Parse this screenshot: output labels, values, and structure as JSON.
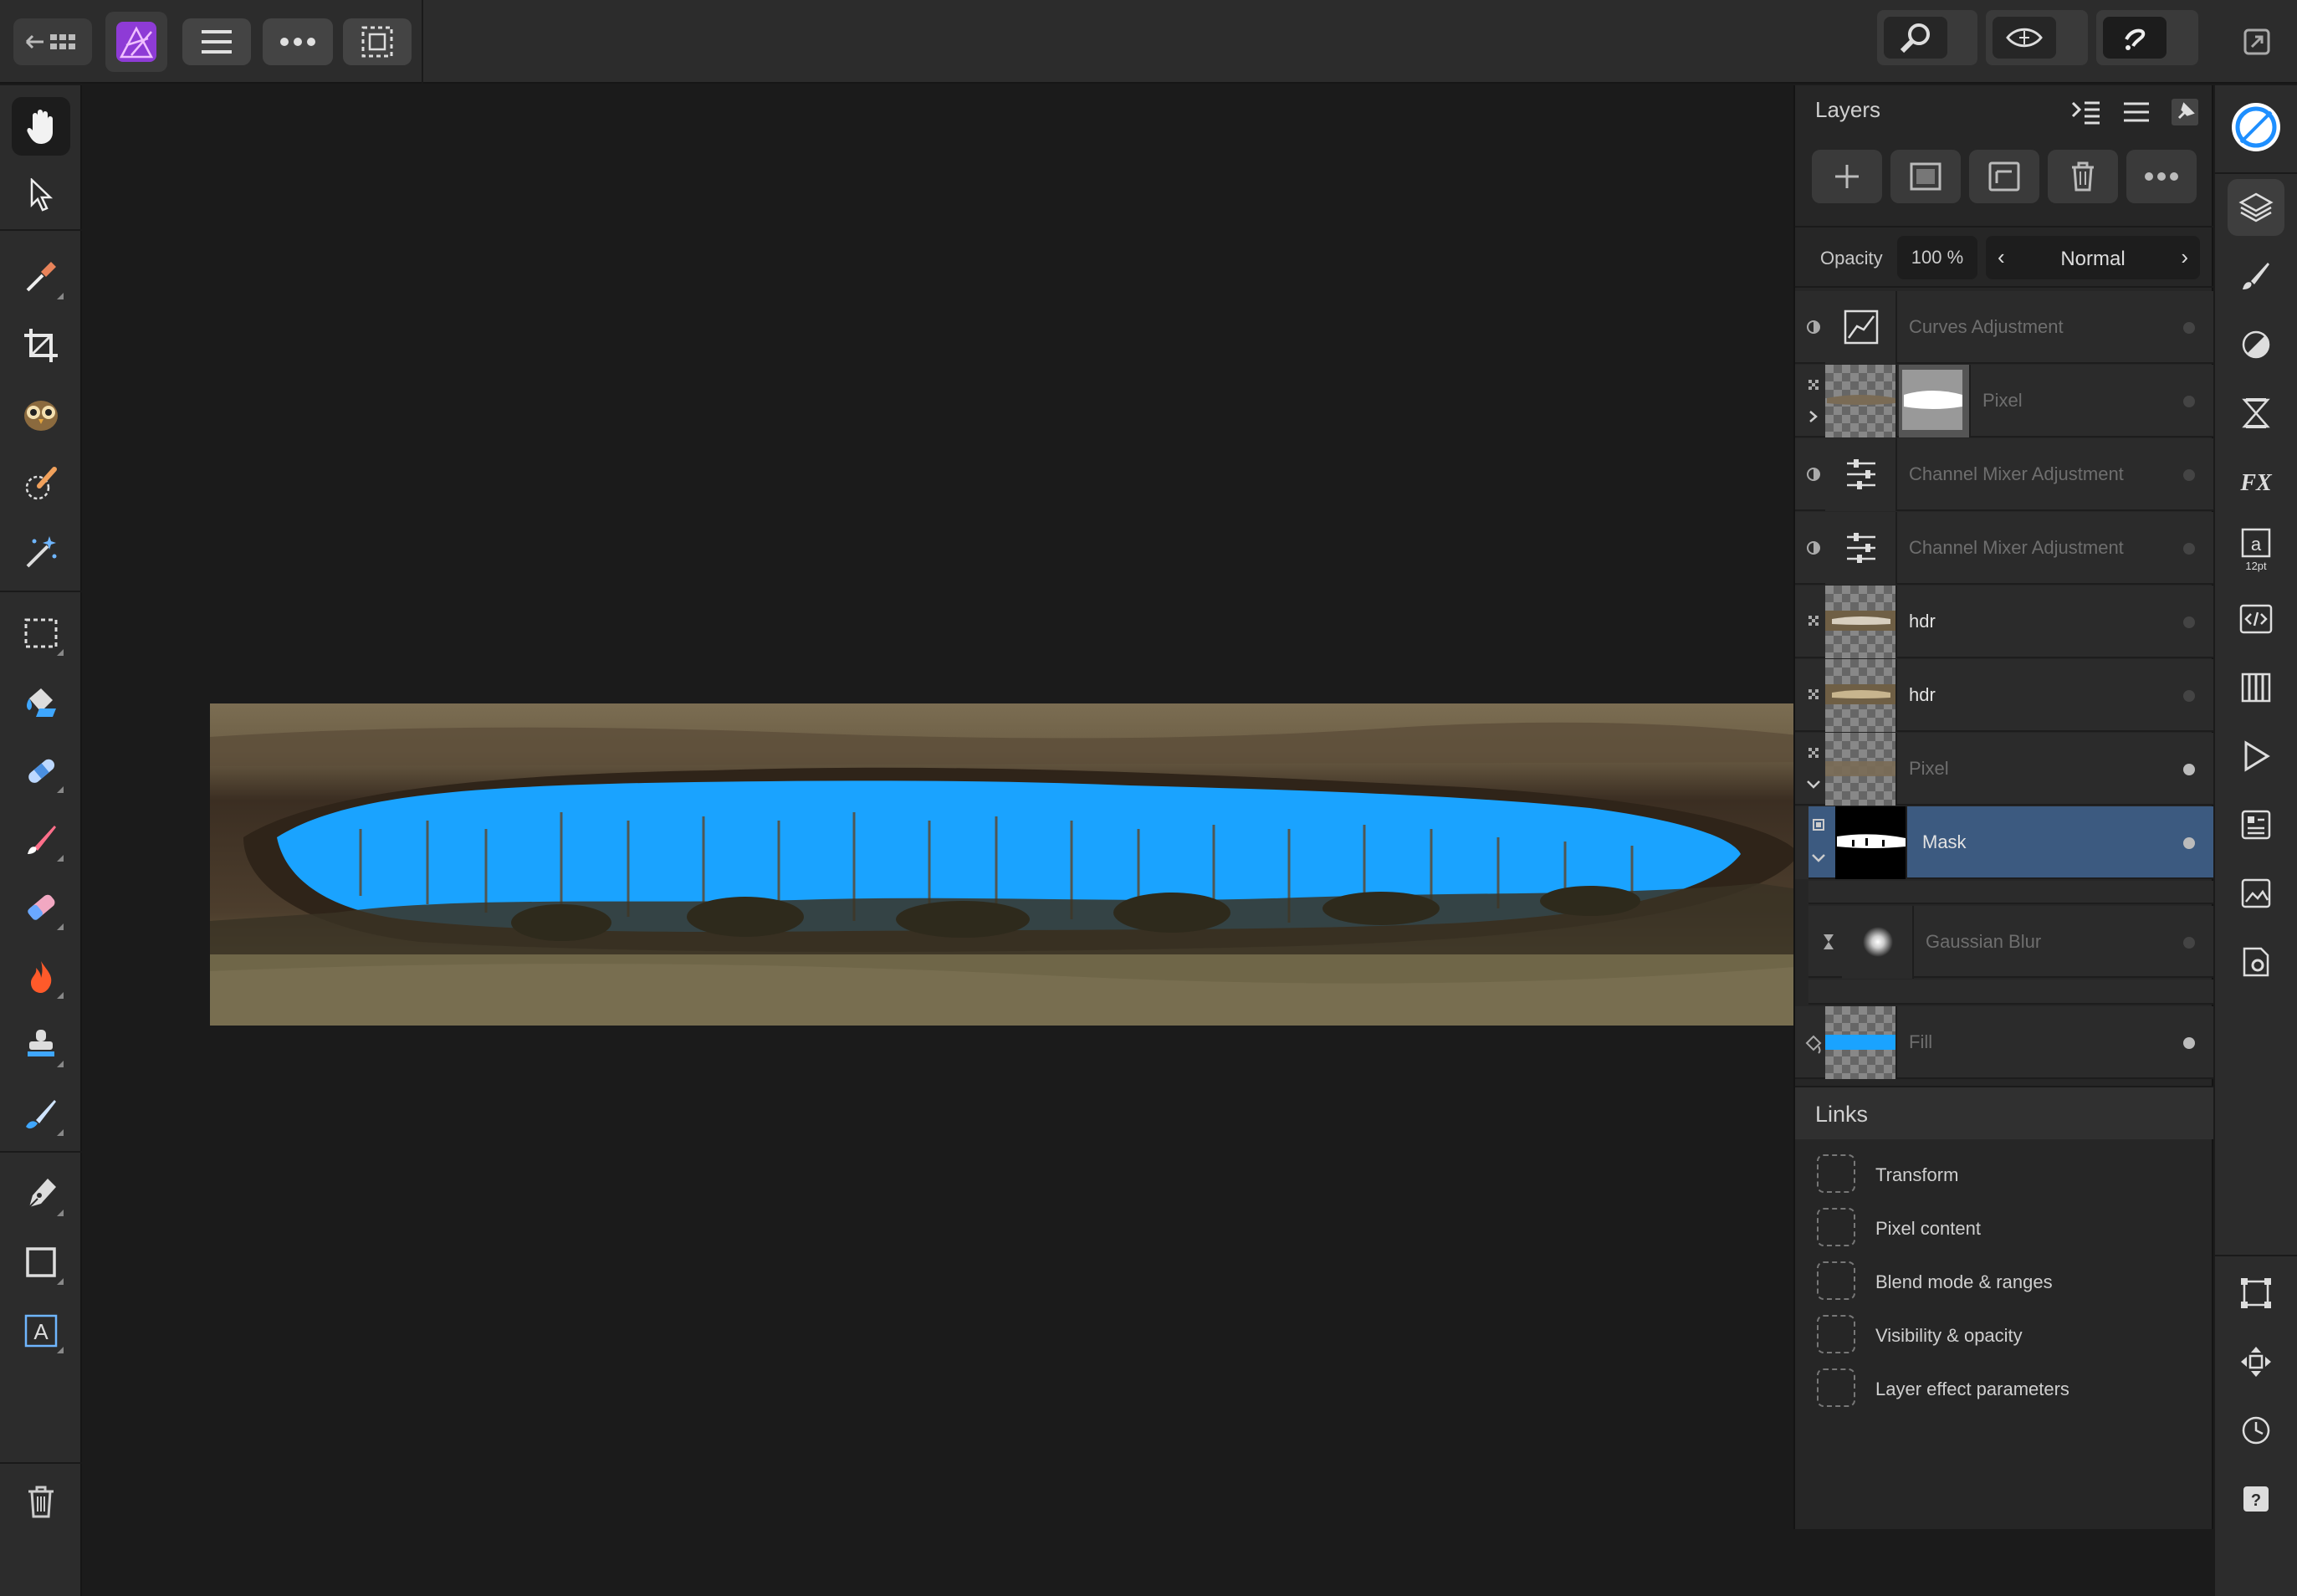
{
  "app": {
    "name": "Affinity Photo"
  },
  "layers_panel": {
    "title": "Layers",
    "opacity_label": "Opacity",
    "opacity_value": "100 %",
    "blend_mode": "Normal",
    "layers": [
      {
        "name": "Curves Adjustment",
        "type": "adjustment",
        "dimmed": true,
        "visible": false
      },
      {
        "name": "Pixel",
        "type": "pixel-with-mask",
        "dimmed": true,
        "visible": false
      },
      {
        "name": "Channel Mixer Adjustment",
        "type": "adjustment",
        "dimmed": true,
        "visible": false
      },
      {
        "name": "Channel Mixer Adjustment",
        "type": "adjustment",
        "dimmed": true,
        "visible": false
      },
      {
        "name": "hdr",
        "type": "pixel",
        "dimmed": false,
        "visible": false
      },
      {
        "name": "hdr",
        "type": "pixel",
        "dimmed": false,
        "visible": false
      },
      {
        "name": "Pixel",
        "type": "pixel",
        "dimmed": true,
        "visible": true
      },
      {
        "name": "Mask",
        "type": "mask",
        "dimmed": false,
        "visible": true,
        "selected": true
      },
      {
        "name": "Gaussian Blur",
        "type": "live-filter",
        "dimmed": true,
        "visible": false
      },
      {
        "name": "Fill",
        "type": "fill",
        "dimmed": true,
        "visible": true
      }
    ]
  },
  "links": {
    "title": "Links",
    "items": [
      "Transform",
      "Pixel content",
      "Blend mode & ranges",
      "Visibility & opacity",
      "Layer effect parameters"
    ]
  },
  "studio": {
    "text_size_label": "12pt"
  },
  "colors": {
    "accent": "#3c5a80",
    "mask_fill": "#1aa3ff"
  }
}
